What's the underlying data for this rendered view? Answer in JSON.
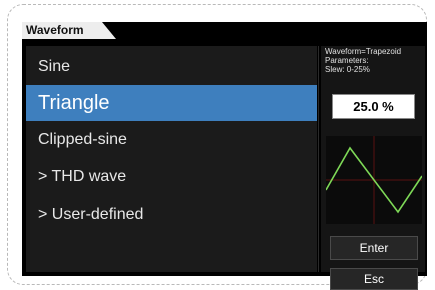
{
  "tab": {
    "label": "Waveform"
  },
  "menu": {
    "items": [
      {
        "label": "Sine",
        "selected": false
      },
      {
        "label": "Triangle",
        "selected": true
      },
      {
        "label": "Clipped-sine",
        "selected": false
      },
      {
        "label": "> THD wave",
        "selected": false
      },
      {
        "label": "> User-defined",
        "selected": false
      }
    ]
  },
  "panel": {
    "waveform_line": "Waveform=Trapezoid",
    "parameters_line": "Parameters:",
    "slew_line": "Slew:  0-25%",
    "value": "25.0 %",
    "enter_label": "Enter",
    "esc_label": "Esc"
  },
  "colors": {
    "selection": "#3e7fbe",
    "preview_wave": "#7ed957",
    "preview_grid": "#5a1010"
  }
}
